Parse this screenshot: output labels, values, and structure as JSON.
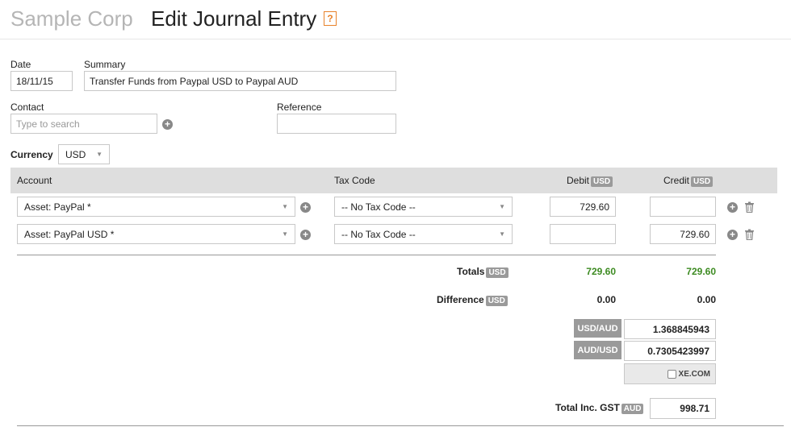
{
  "header": {
    "org": "Sample Corp",
    "title": "Edit Journal Entry",
    "help": "?"
  },
  "form": {
    "date_label": "Date",
    "date_value": "18/11/15",
    "summary_label": "Summary",
    "summary_value": "Transfer Funds from Paypal USD to Paypal AUD",
    "contact_label": "Contact",
    "contact_placeholder": "Type to search",
    "reference_label": "Reference",
    "reference_value": "",
    "currency_label": "Currency",
    "currency_value": "USD"
  },
  "table": {
    "headers": {
      "account": "Account",
      "tax": "Tax Code",
      "debit": "Debit",
      "credit": "Credit",
      "currency_badge": "USD"
    },
    "rows": [
      {
        "account": "Asset: PayPal *",
        "tax": "-- No Tax Code --",
        "debit": "729.60",
        "credit": ""
      },
      {
        "account": "Asset: PayPal USD *",
        "tax": "-- No Tax Code --",
        "debit": "",
        "credit": "729.60"
      }
    ]
  },
  "totals": {
    "totals_label": "Totals",
    "totals_badge": "USD",
    "debit_total": "729.60",
    "credit_total": "729.60",
    "difference_label": "Difference",
    "difference_badge": "USD",
    "debit_diff": "0.00",
    "credit_diff": "0.00"
  },
  "rates": {
    "usd_aud_label": "USD/AUD",
    "usd_aud_value": "1.368845943",
    "aud_usd_label": "AUD/USD",
    "aud_usd_value": "0.7305423997",
    "xe_label": "XE.COM"
  },
  "gst": {
    "label": "Total Inc. GST",
    "badge": "AUD",
    "value": "998.71"
  },
  "icons": {
    "plus": "+",
    "caret": "▼"
  }
}
